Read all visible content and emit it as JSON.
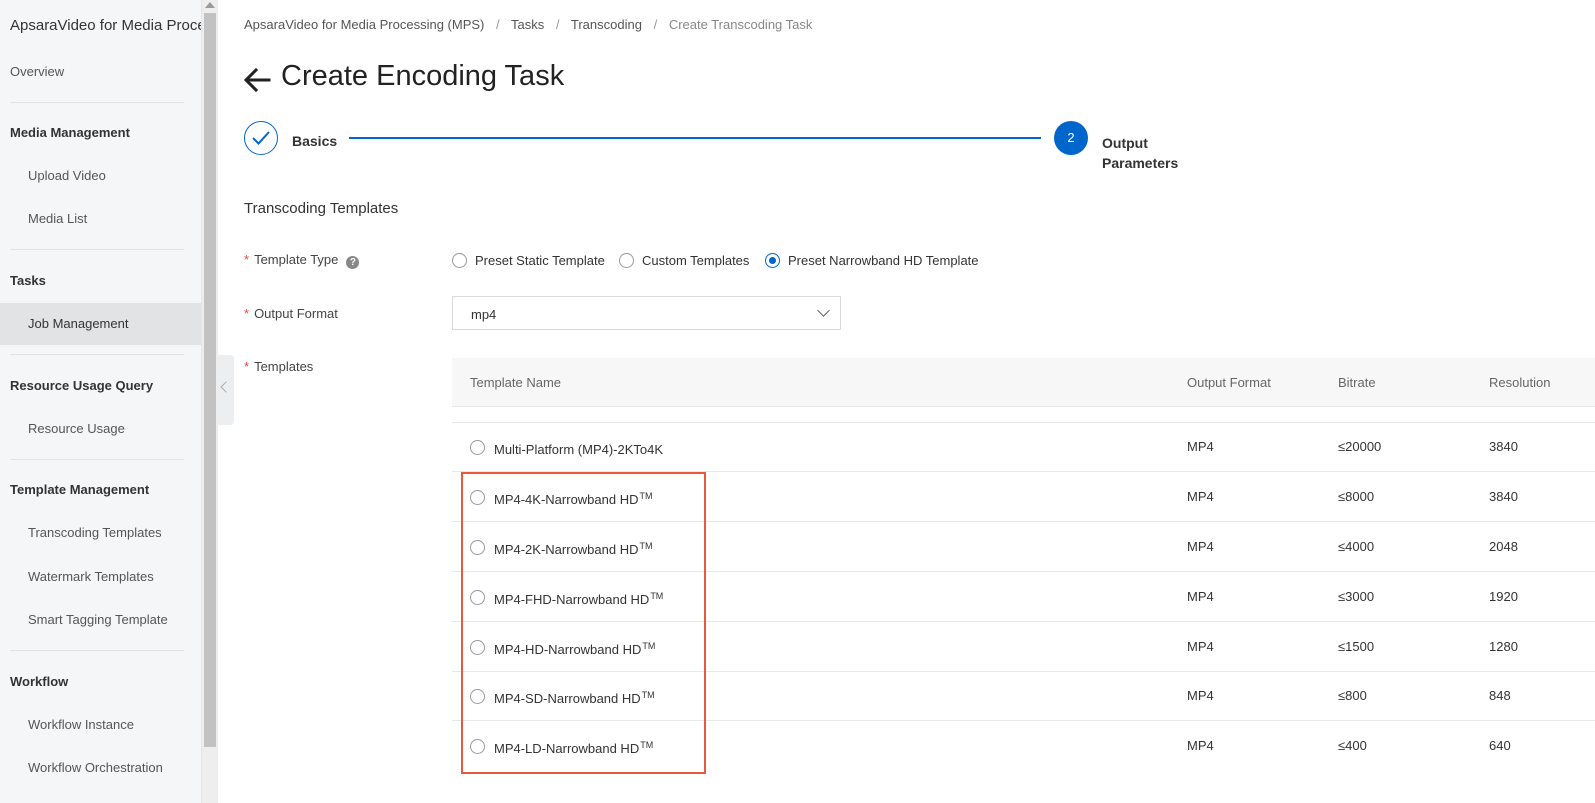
{
  "sidebar": {
    "title": "ApsaraVideo for Media Processing",
    "overview": "Overview",
    "media_group": "Media Management",
    "upload_video": "Upload Video",
    "media_list": "Media List",
    "tasks_group": "Tasks",
    "job_management": "Job Management",
    "usage_group": "Resource Usage Query",
    "resource_usage": "Resource Usage",
    "template_group": "Template Management",
    "transcoding_templates": "Transcoding Templates",
    "watermark_templates": "Watermark Templates",
    "smart_tagging": "Smart Tagging Template",
    "workflow_group": "Workflow",
    "workflow_instance": "Workflow Instance",
    "workflow_orchestration": "Workflow Orchestration"
  },
  "breadcrumb": {
    "root": "ApsaraVideo for Media Processing (MPS)",
    "tasks": "Tasks",
    "transcoding": "Transcoding",
    "current": "Create Transcoding Task",
    "separator": "/"
  },
  "page": {
    "title": "Create Encoding Task"
  },
  "steps": {
    "step1": "Basics",
    "step2_number": "2",
    "step2": "Output Parameters"
  },
  "form": {
    "section_title": "Transcoding Templates",
    "required_mark": "*",
    "template_type_label": "Template Type",
    "help_glyph": "?",
    "template_type_options": [
      "Preset Static Template",
      "Custom Templates",
      "Preset Narrowband HD Template"
    ],
    "template_type_selected": "Preset Narrowband HD Template",
    "output_format_label": "Output Format",
    "output_format_value": "mp4",
    "templates_label": "Templates"
  },
  "table": {
    "headers": {
      "name": "Template Name",
      "format": "Output Format",
      "bitrate": "Bitrate",
      "resolution": "Resolution"
    },
    "rows": [
      {
        "name": "Multi-Platform (MP4)-2KTo4K",
        "tm": "",
        "format": "MP4",
        "bitrate": "≤20000",
        "resolution": "3840"
      },
      {
        "name": "MP4-4K-Narrowband HD",
        "tm": "TM",
        "format": "MP4",
        "bitrate": "≤8000",
        "resolution": "3840"
      },
      {
        "name": "MP4-2K-Narrowband HD",
        "tm": "TM",
        "format": "MP4",
        "bitrate": "≤4000",
        "resolution": "2048"
      },
      {
        "name": "MP4-FHD-Narrowband HD",
        "tm": "TM",
        "format": "MP4",
        "bitrate": "≤3000",
        "resolution": "1920"
      },
      {
        "name": "MP4-HD-Narrowband HD",
        "tm": "TM",
        "format": "MP4",
        "bitrate": "≤1500",
        "resolution": "1280"
      },
      {
        "name": "MP4-SD-Narrowband HD",
        "tm": "TM",
        "format": "MP4",
        "bitrate": "≤800",
        "resolution": "848"
      },
      {
        "name": "MP4-LD-Narrowband HD",
        "tm": "TM",
        "format": "MP4",
        "bitrate": "≤400",
        "resolution": "640"
      }
    ]
  },
  "colors": {
    "primary": "#0066cc",
    "required": "#e04a3f",
    "highlight": "#e85a3c"
  }
}
